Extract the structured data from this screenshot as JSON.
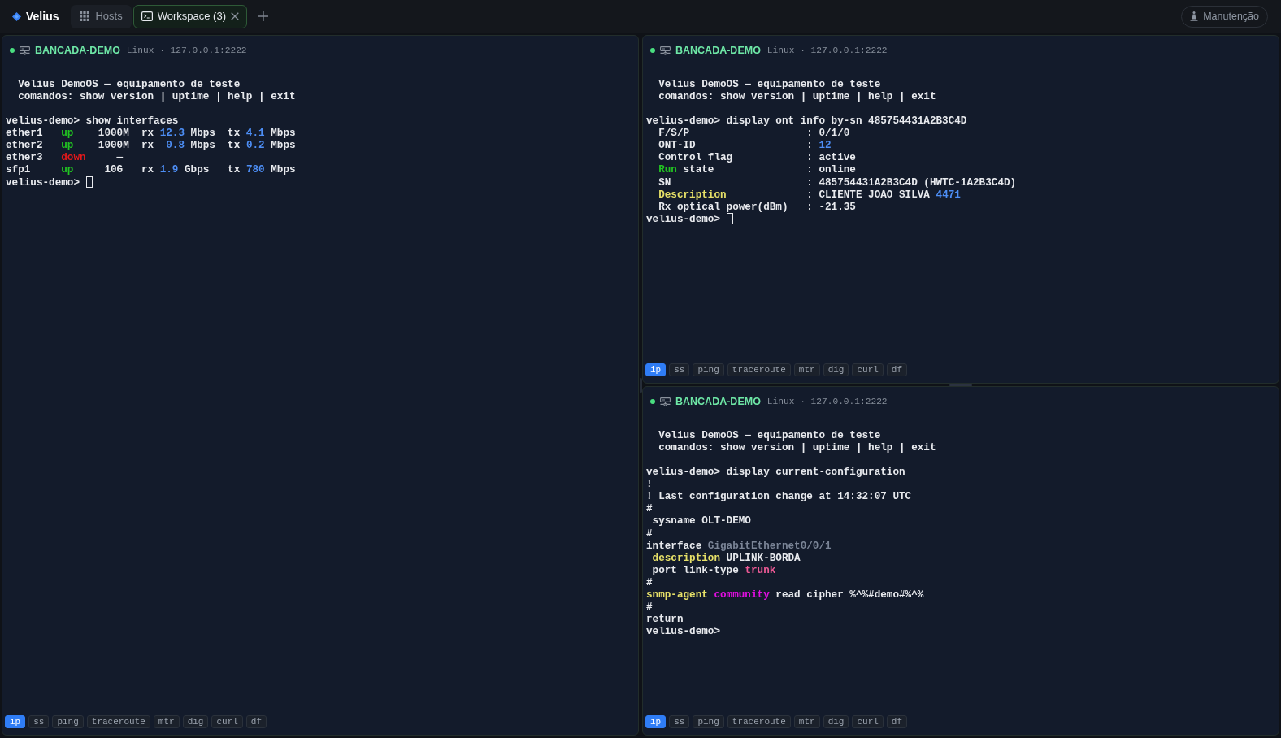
{
  "topbar": {
    "app_name": "Velius",
    "tabs": [
      {
        "kind": "hosts",
        "label": "Hosts",
        "selected": false,
        "closable": false
      },
      {
        "kind": "workspace",
        "label": "Workspace (3)",
        "selected": true,
        "closable": true
      }
    ],
    "maintenance": "Manutenção"
  },
  "panes": [
    {
      "connected": true,
      "host": "BANCADA-DEMO",
      "meta": "Linux · 127.0.0.1:2222",
      "banner": [
        "  Velius DemoOS — equipamento de teste",
        "  comandos: show version | uptime | help | exit"
      ],
      "output": [
        "velius-demo> show interfaces",
        [
          "ether1   ",
          {
            "text": "up",
            "kind": "ok"
          },
          "    1000M  rx ",
          {
            "text": "12.3",
            "kind": "value"
          },
          " Mbps  tx ",
          {
            "text": "4.1",
            "kind": "value"
          },
          " Mbps"
        ],
        [
          "ether2   ",
          {
            "text": "up",
            "kind": "ok"
          },
          "    1000M  rx  ",
          {
            "text": "0.8",
            "kind": "value"
          },
          " Mbps  tx ",
          {
            "text": "0.2",
            "kind": "value"
          },
          " Mbps"
        ],
        [
          "ether3   ",
          {
            "text": "down",
            "kind": "error"
          },
          "     —"
        ],
        [
          "sfp1     ",
          {
            "text": "up",
            "kind": "ok"
          },
          "     10G   rx ",
          {
            "text": "1.9",
            "kind": "value"
          },
          " Gbps   tx ",
          {
            "text": "780",
            "kind": "value"
          },
          " Mbps"
        ],
        "velius-demo>"
      ],
      "cursor": true,
      "chips": [
        {
          "label": "ip",
          "selected": true
        },
        {
          "label": "ss",
          "selected": false
        },
        {
          "label": "ping",
          "selected": false
        },
        {
          "label": "traceroute",
          "selected": false
        },
        {
          "label": "mtr",
          "selected": false
        },
        {
          "label": "dig",
          "selected": false
        },
        {
          "label": "curl",
          "selected": false
        },
        {
          "label": "df",
          "selected": false
        }
      ]
    },
    {
      "connected": true,
      "host": "BANCADA-DEMO",
      "meta": "Linux · 127.0.0.1:2222",
      "banner": [
        "  Velius DemoOS — equipamento de teste",
        "  comandos: show version | uptime | help | exit"
      ],
      "output": [
        "velius-demo> display ont info by-sn 485754431A2B3C4D",
        "  F/S/P                   : 0/1/0",
        [
          "  ONT-ID                  : ",
          {
            "text": "12",
            "kind": "value"
          }
        ],
        "  Control flag            : active",
        [
          {
            "text": "  Run",
            "kind": "ok"
          },
          " state               : online"
        ],
        "  SN                      : 485754431A2B3C4D (HWTC-1A2B3C4D)",
        [
          {
            "text": "  Description",
            "kind": "label"
          },
          "             : CLIENTE JOAO SILVA ",
          {
            "text": "4471",
            "kind": "value"
          }
        ],
        "  Rx optical power(dBm)   : -21.35",
        "velius-demo>"
      ],
      "cursor": true,
      "chips": [
        {
          "label": "ip",
          "selected": true
        },
        {
          "label": "ss",
          "selected": false
        },
        {
          "label": "ping",
          "selected": false
        },
        {
          "label": "traceroute",
          "selected": false
        },
        {
          "label": "mtr",
          "selected": false
        },
        {
          "label": "dig",
          "selected": false
        },
        {
          "label": "curl",
          "selected": false
        },
        {
          "label": "df",
          "selected": false
        }
      ]
    },
    {
      "connected": true,
      "host": "BANCADA-DEMO",
      "meta": "Linux · 127.0.0.1:2222",
      "banner": [
        "  Velius DemoOS — equipamento de teste",
        "  comandos: show version | uptime | help | exit"
      ],
      "output": [
        "velius-demo> display current-configuration",
        "!",
        "! Last configuration change at 14:32:07 UTC",
        "#",
        " sysname OLT-DEMO",
        "#",
        [
          "interface ",
          {
            "text": "GigabitEthernet0/0/1",
            "kind": "muted"
          }
        ],
        [
          {
            "text": " description",
            "kind": "label"
          },
          " UPLINK-BORDA"
        ],
        [
          " port link-type ",
          {
            "text": "trunk",
            "kind": "accent"
          }
        ],
        "#",
        [
          {
            "text": "snmp-agent",
            "kind": "label"
          },
          {
            "text": " community",
            "kind": "keyword"
          },
          " read cipher %^%#demo#%^%"
        ],
        "#",
        "return",
        "velius-demo>"
      ],
      "cursor": false,
      "chips": [
        {
          "label": "ip",
          "selected": true
        },
        {
          "label": "ss",
          "selected": false
        },
        {
          "label": "ping",
          "selected": false
        },
        {
          "label": "traceroute",
          "selected": false
        },
        {
          "label": "mtr",
          "selected": false
        },
        {
          "label": "dig",
          "selected": false
        },
        {
          "label": "curl",
          "selected": false
        },
        {
          "label": "df",
          "selected": false
        }
      ]
    }
  ]
}
